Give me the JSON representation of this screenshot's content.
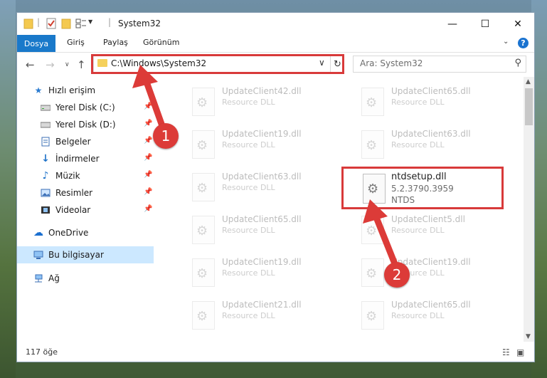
{
  "window": {
    "title": "System32"
  },
  "ribbon": {
    "tabs": [
      "Dosya",
      "Giriş",
      "Paylaş",
      "Görünüm"
    ]
  },
  "navbar": {
    "address": "C:\\Windows\\System32",
    "search_placeholder": "Ara: System32"
  },
  "sidebar": {
    "quick_access": "Hızlı erişim",
    "items": [
      {
        "label": "Yerel Disk (C:)"
      },
      {
        "label": "Yerel Disk (D:)"
      },
      {
        "label": "Belgeler"
      },
      {
        "label": "İndirmeler"
      },
      {
        "label": "Müzik"
      },
      {
        "label": "Resimler"
      },
      {
        "label": "Videolar"
      }
    ],
    "onedrive": "OneDrive",
    "this_pc": "Bu bilgisayar",
    "network": "Ağ"
  },
  "files": {
    "left": [
      {
        "name": "UpdateClient42.dll",
        "type": "Resource DLL"
      },
      {
        "name": "UpdateClient19.dll",
        "type": "Resource DLL"
      },
      {
        "name": "UpdateClient63.dll",
        "type": "Resource DLL"
      },
      {
        "name": "UpdateClient65.dll",
        "type": "Resource DLL"
      },
      {
        "name": "UpdateClient19.dll",
        "type": "Resource DLL"
      },
      {
        "name": "UpdateClient21.dll",
        "type": "Resource DLL"
      }
    ],
    "right": [
      {
        "name": "UpdateClient65.dll",
        "type": "Resource DLL"
      },
      {
        "name": "UpdateClient63.dll",
        "type": "Resource DLL"
      },
      {
        "name": "UpdateClient5.dll",
        "type": "Resource DLL"
      },
      {
        "name": "UpdateClient19.dll",
        "type": "Resource DLL"
      },
      {
        "name": "UpdateClient65.dll",
        "type": "Resource DLL"
      }
    ],
    "highlighted": {
      "name": "ntdsetup.dll",
      "version": "5.2.3790.3959",
      "product": "NTDS"
    }
  },
  "status": {
    "count": "117 öğe"
  },
  "annotations": {
    "step1": "1",
    "step2": "2"
  },
  "colors": {
    "accent": "#1979ca",
    "annotation": "#d83a3a"
  }
}
